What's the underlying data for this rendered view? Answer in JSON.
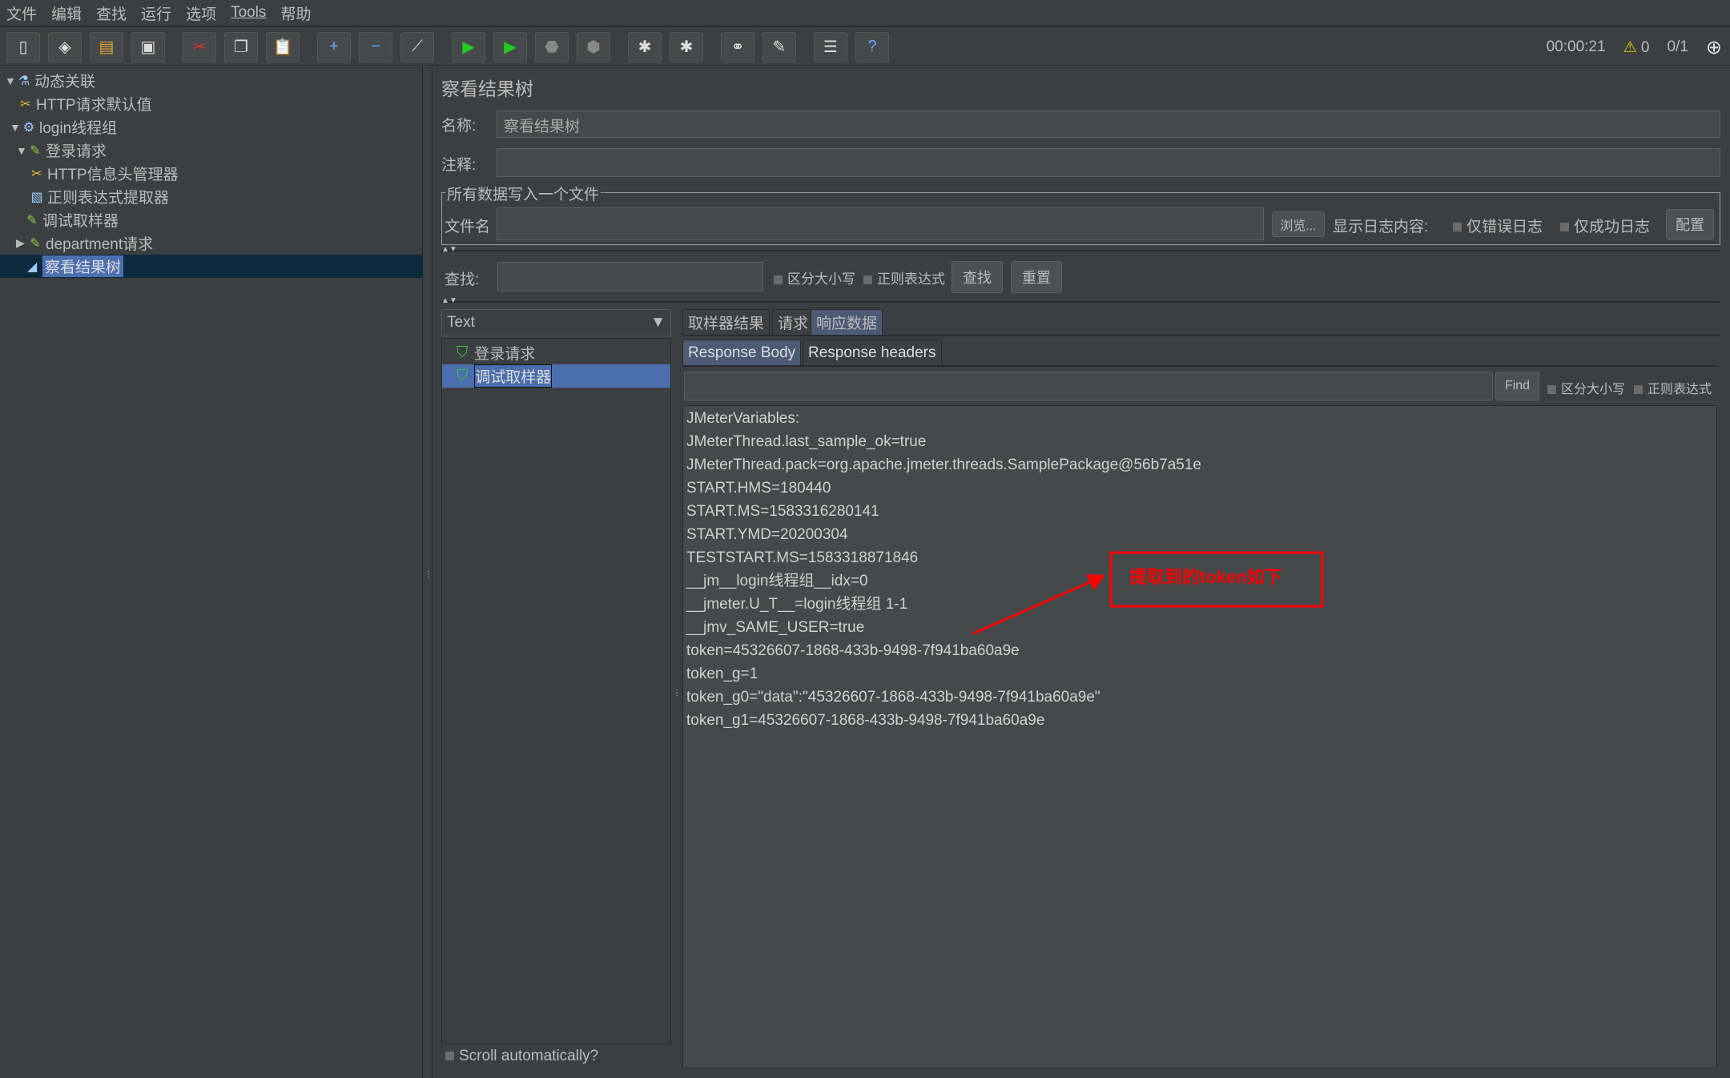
{
  "menu": [
    "文件",
    "编辑",
    "查找",
    "运行",
    "选项",
    "Tools",
    "帮助"
  ],
  "toolbar_icons": [
    "new-icon",
    "templates-icon",
    "open-icon",
    "save-icon",
    "cut-icon",
    "copy-icon",
    "paste-icon",
    "expand-icon",
    "collapse-icon",
    "toggle-icon",
    "start-icon",
    "start-no-pause-icon",
    "stop-icon",
    "shutdown-icon",
    "clear-icon",
    "clear-all-icon",
    "search-icon",
    "reset-search-icon",
    "function-helper-icon",
    "help-icon"
  ],
  "status": {
    "timer": "00:00:21",
    "warnings": "0",
    "threads": "0/1"
  },
  "tree": [
    {
      "label": "动态关联",
      "icon": "test-plan-icon",
      "expanded": true
    },
    {
      "label": "HTTP请求默认值",
      "icon": "config-icon"
    },
    {
      "label": "login线程组",
      "icon": "thread-group-icon",
      "expanded": true
    },
    {
      "label": "登录请求",
      "icon": "sampler-icon",
      "expanded": true
    },
    {
      "label": "HTTP信息头管理器",
      "icon": "config-icon"
    },
    {
      "label": "正则表达式提取器",
      "icon": "extractor-icon"
    },
    {
      "label": "调试取样器",
      "icon": "sampler-icon"
    },
    {
      "label": "department请求",
      "icon": "sampler-icon",
      "expanded": false
    },
    {
      "label": "察看结果树",
      "icon": "listener-icon",
      "selected": true
    }
  ],
  "panel": {
    "title": "察看结果树",
    "name_label": "名称:",
    "name_value": "察看结果树",
    "comment_label": "注释:",
    "comment_value": "",
    "fieldset_legend": "所有数据写入一个文件",
    "filename_label": "文件名",
    "filename_value": "",
    "browse": "浏览...",
    "log_label": "显示日志内容:",
    "errors_only": "仅错误日志",
    "success_only": "仅成功日志",
    "configure": "配置",
    "search_label": "查找:",
    "search_value": "",
    "case_sensitive": "区分大小写",
    "regex": "正则表达式",
    "find_btn": "查找",
    "reset_btn": "重置"
  },
  "renderer": "Text",
  "samples": [
    {
      "label": "登录请求"
    },
    {
      "label": "调试取样器",
      "selected": true
    }
  ],
  "tabs": [
    "取样器结果",
    "请求",
    "响应数据"
  ],
  "active_tab": "响应数据",
  "subtabs": [
    "Response Body",
    "Response headers"
  ],
  "active_subtab": "Response Body",
  "find": {
    "value": "",
    "button": "Find",
    "case_sensitive": "区分大小写",
    "regex": "正则表达式"
  },
  "response_lines": [
    "JMeterVariables:",
    "JMeterThread.last_sample_ok=true",
    "JMeterThread.pack=org.apache.jmeter.threads.SamplePackage@56b7a51e",
    "START.HMS=180440",
    "START.MS=1583316280141",
    "START.YMD=20200304",
    "TESTSTART.MS=1583318871846",
    "__jm__login线程组__idx=0",
    "__jmeter.U_T__=login线程组 1-1",
    "__jmv_SAME_USER=true",
    "token=45326607-1868-433b-9498-7f941ba60a9e",
    "token_g=1",
    "token_g0=\"data\":\"45326607-1868-433b-9498-7f941ba60a9e\"",
    "token_g1=45326607-1868-433b-9498-7f941ba60a9e"
  ],
  "annotation": {
    "text": "提取到的token如下",
    "color": "#ff0000"
  },
  "scroll_auto": "Scroll automatically?"
}
